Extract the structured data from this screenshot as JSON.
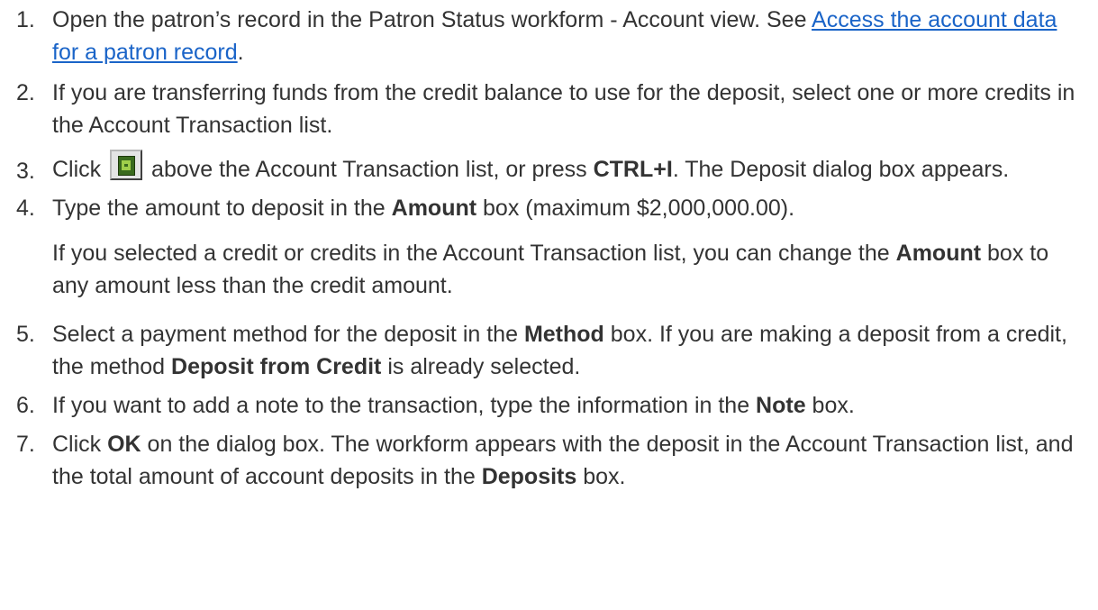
{
  "steps": [
    {
      "num": "1.",
      "t1": "Open the patron’s record in the Patron Status workform - Account view. See ",
      "link": "Access the account data for a patron record",
      "t2": "."
    },
    {
      "num": "2.",
      "t1": "If you are transferring funds from the credit balance to use for the deposit, select one or more credits in the Account Transaction list."
    },
    {
      "num": "3.",
      "t1": "Click ",
      "icon": "deposit-toolbar-icon",
      "t2": " above the Account Transaction list, or press ",
      "b1": "CTRL+I",
      "t3": ". The Deposit dia­log box appears."
    },
    {
      "num": "4.",
      "t1": "Type the amount to deposit in the ",
      "b1": "Amount",
      "t2": " box (maximum $2,000,000.00).",
      "p2_t1": "If you selected a credit or credits in the Account Transaction list, you can change the ",
      "p2_b1": "Amount",
      "p2_t2": " box to any amount less than the credit amount."
    },
    {
      "num": "5.",
      "t1": "Select a payment method for the deposit in the ",
      "b1": "Method",
      "t2": " box. If you are making a deposit from a credit, the method ",
      "b2": "Deposit from Credit",
      "t3": " is already selected."
    },
    {
      "num": "6.",
      "t1": "If you want to add a note to the transaction, type the information in the ",
      "b1": "Note",
      "t2": " box."
    },
    {
      "num": "7.",
      "t1": "Click ",
      "b1": "OK",
      "t2": " on the dialog box. The workform appears with the deposit in the Account Transaction list, and the total amount of account deposits in the ",
      "b2": "Deposits",
      "t3": " box."
    }
  ]
}
